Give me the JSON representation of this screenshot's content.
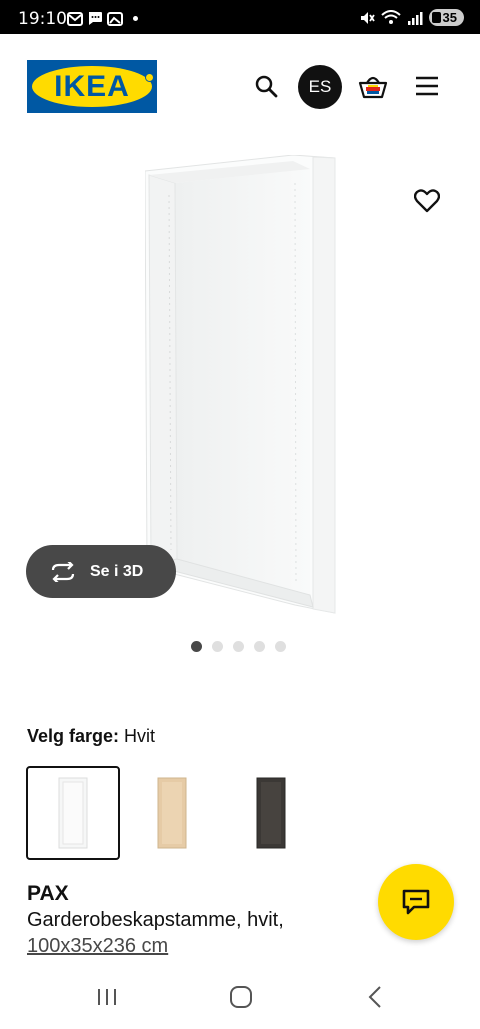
{
  "status_bar": {
    "time": "19:10",
    "battery": "35",
    "icons": [
      "mail-icon",
      "chat-bubble-icon",
      "gallery-icon",
      "dot-icon",
      "mute-icon",
      "wifi-6e-icon",
      "signal-icon",
      "battery-icon"
    ]
  },
  "header": {
    "logo_text": "IKEA",
    "avatar_initials": "ES",
    "icons": [
      "search-icon",
      "cart-icon",
      "menu-icon"
    ]
  },
  "gallery": {
    "view_3d_label": "Se i 3D",
    "image_count": 5,
    "active_image_index": 0
  },
  "color": {
    "label": "Velg farge:",
    "selected": "Hvit",
    "options": [
      {
        "name": "Hvit",
        "color": "#f4f4f2",
        "selected": true
      },
      {
        "name": "Eikemønster",
        "color": "#e3c8a4",
        "selected": false
      },
      {
        "name": "Svartbrun",
        "color": "#3e3b38",
        "selected": false
      }
    ]
  },
  "product": {
    "name": "PAX",
    "description": "Garderobeskapstamme, hvit,",
    "size": "100x35x236 cm"
  },
  "colors": {
    "ikea_blue": "#0058a3",
    "ikea_yellow": "#ffdb00",
    "dark_grey": "#484848"
  }
}
